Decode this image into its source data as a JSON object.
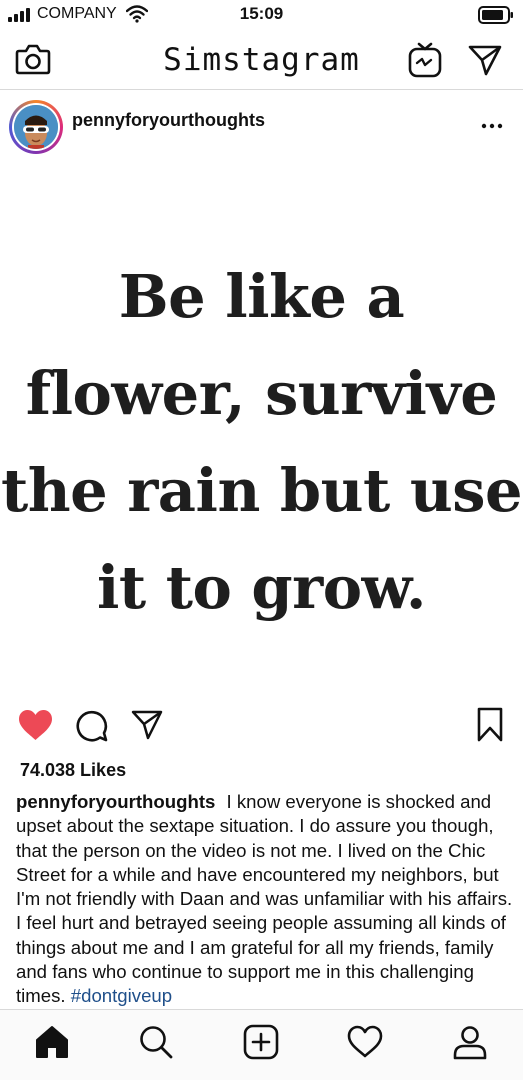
{
  "status_bar": {
    "carrier": "COMPANY",
    "time": "15:09"
  },
  "header": {
    "title": "Simstagram",
    "icons": [
      "camera-icon",
      "igtv-icon",
      "direct-message-icon"
    ]
  },
  "post": {
    "username": "pennyforyourthoughts",
    "quote_lines": [
      "Be like a",
      "flower, survive",
      "the rain but use",
      "it to grow."
    ],
    "liked": true,
    "likes_text": "74.038 Likes",
    "caption": {
      "username": "pennyforyourthoughts",
      "text": "I know everyone is shocked and upset about the sextape situation. I do assure you though, that the person on the video is not me. I lived on the Chic Street for a while and have encountered my neighbors, but I'm not friendly with Daan and was unfamiliar with his affairs. I feel hurt and betrayed seeing people assuming all kinds of things about me and I am grateful for all my friends, family and fans who continue to support me in this challenging times.",
      "hashtag": "#dontgiveup"
    }
  },
  "tab_bar": {
    "items": [
      "home-icon",
      "search-icon",
      "new-post-icon",
      "activity-icon",
      "profile-icon"
    ],
    "active": "home-icon"
  },
  "colors": {
    "like_red": "#ed4956",
    "hashtag_blue": "#1f4f8a",
    "divider": "#d9d9d9"
  }
}
